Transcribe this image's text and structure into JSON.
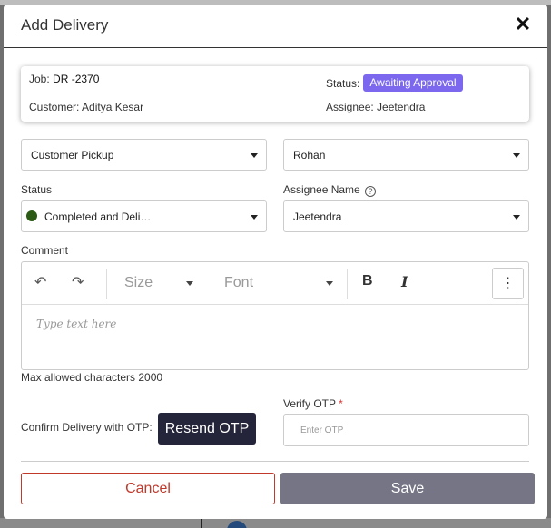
{
  "modal": {
    "title": "Add Delivery"
  },
  "info": {
    "job_label": "Job:",
    "job_value": "DR -2370",
    "customer_label": "Customer:",
    "customer_value": "Aditya Kesar",
    "status_label": "Status:",
    "status_badge": "Awaiting Approval",
    "assignee_label": "Assignee:",
    "assignee_value": "Jeetendra",
    "badge_color": "#7b68ee"
  },
  "form": {
    "delivery_method_value": "Customer Pickup",
    "delivered_by_value": "Rohan",
    "status_label": "Status",
    "status_value": "Completed and Deli…",
    "status_color": "#2b5a14",
    "assignee_name_label": "Assignee Name",
    "assignee_name_value": "Jeetendra",
    "comment_label": "Comment",
    "editor": {
      "size_label": "Size",
      "font_label": "Font",
      "placeholder": "Type text here",
      "icons": [
        "undo-icon",
        "redo-icon",
        "bold-icon",
        "italic-icon",
        "more-vertical-icon"
      ]
    },
    "max_chars": "Max allowed characters 2000",
    "otp_label": "Confirm Delivery with OTP:",
    "resend_label": "Resend OTP",
    "verify_label": "Verify OTP",
    "verify_required": "*",
    "otp_placeholder": "Enter OTP"
  },
  "actions": {
    "cancel_label": "Cancel",
    "save_label": "Save"
  }
}
